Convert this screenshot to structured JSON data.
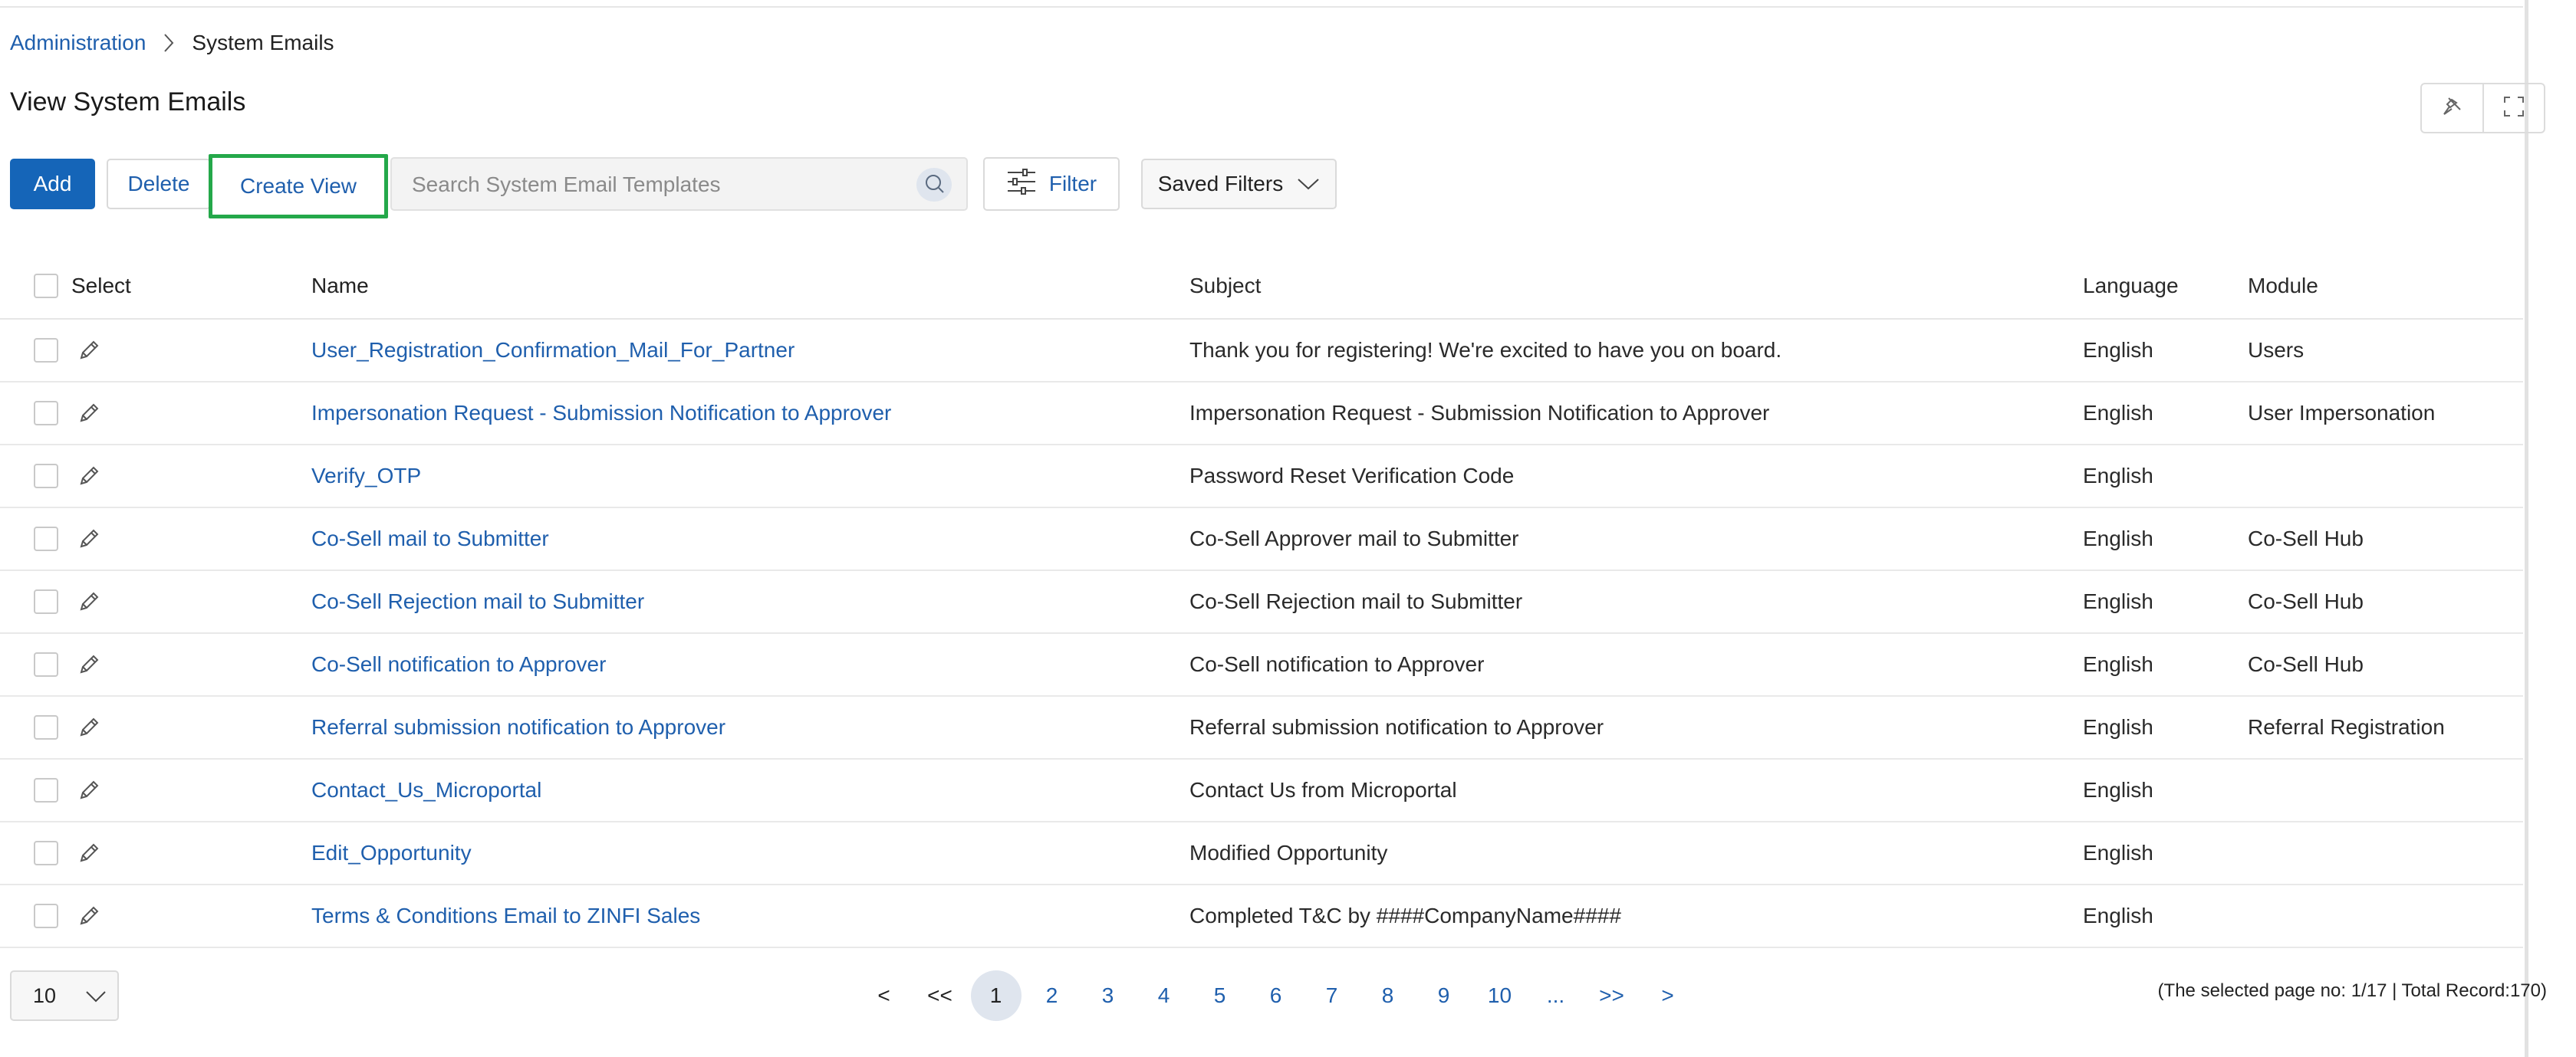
{
  "breadcrumb": {
    "parent": "Administration",
    "current": "System Emails"
  },
  "page": {
    "title": "View System Emails"
  },
  "toolbar": {
    "add_label": "Add",
    "delete_label": "Delete",
    "create_view_label": "Create View",
    "search_placeholder": "Search System Email Templates",
    "search_value": "",
    "filter_label": "Filter",
    "saved_filters_label": "Saved Filters"
  },
  "table": {
    "columns": {
      "select": "Select",
      "name": "Name",
      "subject": "Subject",
      "language": "Language",
      "module": "Module"
    },
    "rows": [
      {
        "name": "User_Registration_Confirmation_Mail_For_Partner",
        "subject": "Thank you for registering! We're excited to have you on board.",
        "language": "English",
        "module": "Users"
      },
      {
        "name": "Impersonation Request - Submission Notification to Approver",
        "subject": "Impersonation Request - Submission Notification to Approver",
        "language": "English",
        "module": "User Impersonation"
      },
      {
        "name": "Verify_OTP",
        "subject": "Password Reset Verification Code",
        "language": "English",
        "module": ""
      },
      {
        "name": "Co-Sell mail to Submitter",
        "subject": "Co-Sell Approver mail to Submitter",
        "language": "English",
        "module": "Co-Sell Hub"
      },
      {
        "name": "Co-Sell Rejection mail to Submitter",
        "subject": "Co-Sell Rejection mail to Submitter",
        "language": "English",
        "module": "Co-Sell Hub"
      },
      {
        "name": "Co-Sell notification to Approver",
        "subject": "Co-Sell notification to Approver",
        "language": "English",
        "module": "Co-Sell Hub"
      },
      {
        "name": "Referral submission notification to Approver",
        "subject": "Referral submission notification to Approver",
        "language": "English",
        "module": "Referral Registration"
      },
      {
        "name": "Contact_Us_Microportal",
        "subject": "Contact Us from Microportal",
        "language": "English",
        "module": ""
      },
      {
        "name": "Edit_Opportunity",
        "subject": "Modified Opportunity",
        "language": "English",
        "module": ""
      },
      {
        "name": "Terms & Conditions Email to ZINFI Sales",
        "subject": "Completed T&C by ####CompanyName####",
        "language": "English",
        "module": ""
      }
    ]
  },
  "pagination": {
    "page_size": "10",
    "prev": "<",
    "first": "<<",
    "pages": [
      "1",
      "2",
      "3",
      "4",
      "5",
      "6",
      "7",
      "8",
      "9",
      "10"
    ],
    "current_page": "1",
    "ellipsis": "...",
    "last": ">>",
    "next": ">",
    "info": "(The selected page no: 1/17 | Total Record:170)"
  },
  "colors": {
    "accent": "#1565b8",
    "link": "#1f5fad",
    "highlight": "#24a84a"
  }
}
